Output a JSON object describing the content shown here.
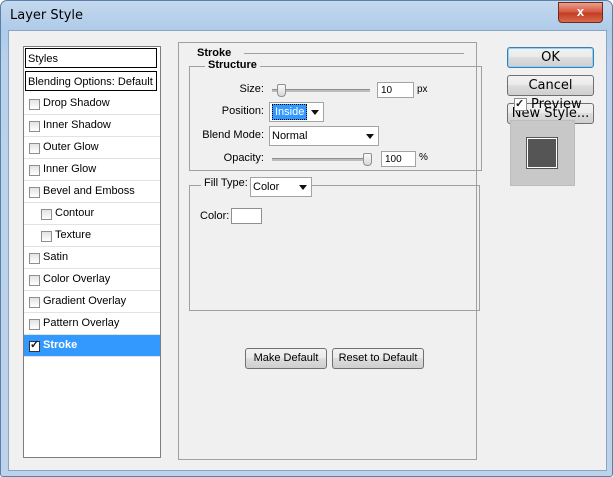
{
  "window": {
    "title": "Layer Style",
    "close": "x"
  },
  "styles": {
    "header": "Styles",
    "blending": "Blending Options: Default",
    "items": [
      {
        "label": "Drop Shadow",
        "checked": false,
        "indent": false
      },
      {
        "label": "Inner Shadow",
        "checked": false,
        "indent": false
      },
      {
        "label": "Outer Glow",
        "checked": false,
        "indent": false
      },
      {
        "label": "Inner Glow",
        "checked": false,
        "indent": false
      },
      {
        "label": "Bevel and Emboss",
        "checked": false,
        "indent": false
      },
      {
        "label": "Contour",
        "checked": false,
        "indent": true
      },
      {
        "label": "Texture",
        "checked": false,
        "indent": true
      },
      {
        "label": "Satin",
        "checked": false,
        "indent": false
      },
      {
        "label": "Color Overlay",
        "checked": false,
        "indent": false
      },
      {
        "label": "Gradient Overlay",
        "checked": false,
        "indent": false
      },
      {
        "label": "Pattern Overlay",
        "checked": false,
        "indent": false
      },
      {
        "label": "Stroke",
        "checked": true,
        "indent": false,
        "selected": true
      }
    ]
  },
  "stroke": {
    "title": "Stroke",
    "structure": {
      "title": "Structure",
      "size_label": "Size:",
      "size_value": "10",
      "size_unit": "px",
      "size_slider_fraction": 0.05,
      "position_label": "Position:",
      "position_value": "Inside",
      "blend_label": "Blend Mode:",
      "blend_value": "Normal",
      "opacity_label": "Opacity:",
      "opacity_value": "100",
      "opacity_unit": "%",
      "opacity_fraction": 1.0
    },
    "fill": {
      "label": "Fill Type:",
      "value": "Color",
      "color_label": "Color:",
      "color": "#ffffff"
    },
    "make_default": "Make Default",
    "reset_default": "Reset to Default"
  },
  "buttons": {
    "ok": "OK",
    "cancel": "Cancel",
    "new_style": "New Style..."
  },
  "preview": {
    "label": "Preview",
    "checked": true,
    "swatch_color": "#555555"
  }
}
